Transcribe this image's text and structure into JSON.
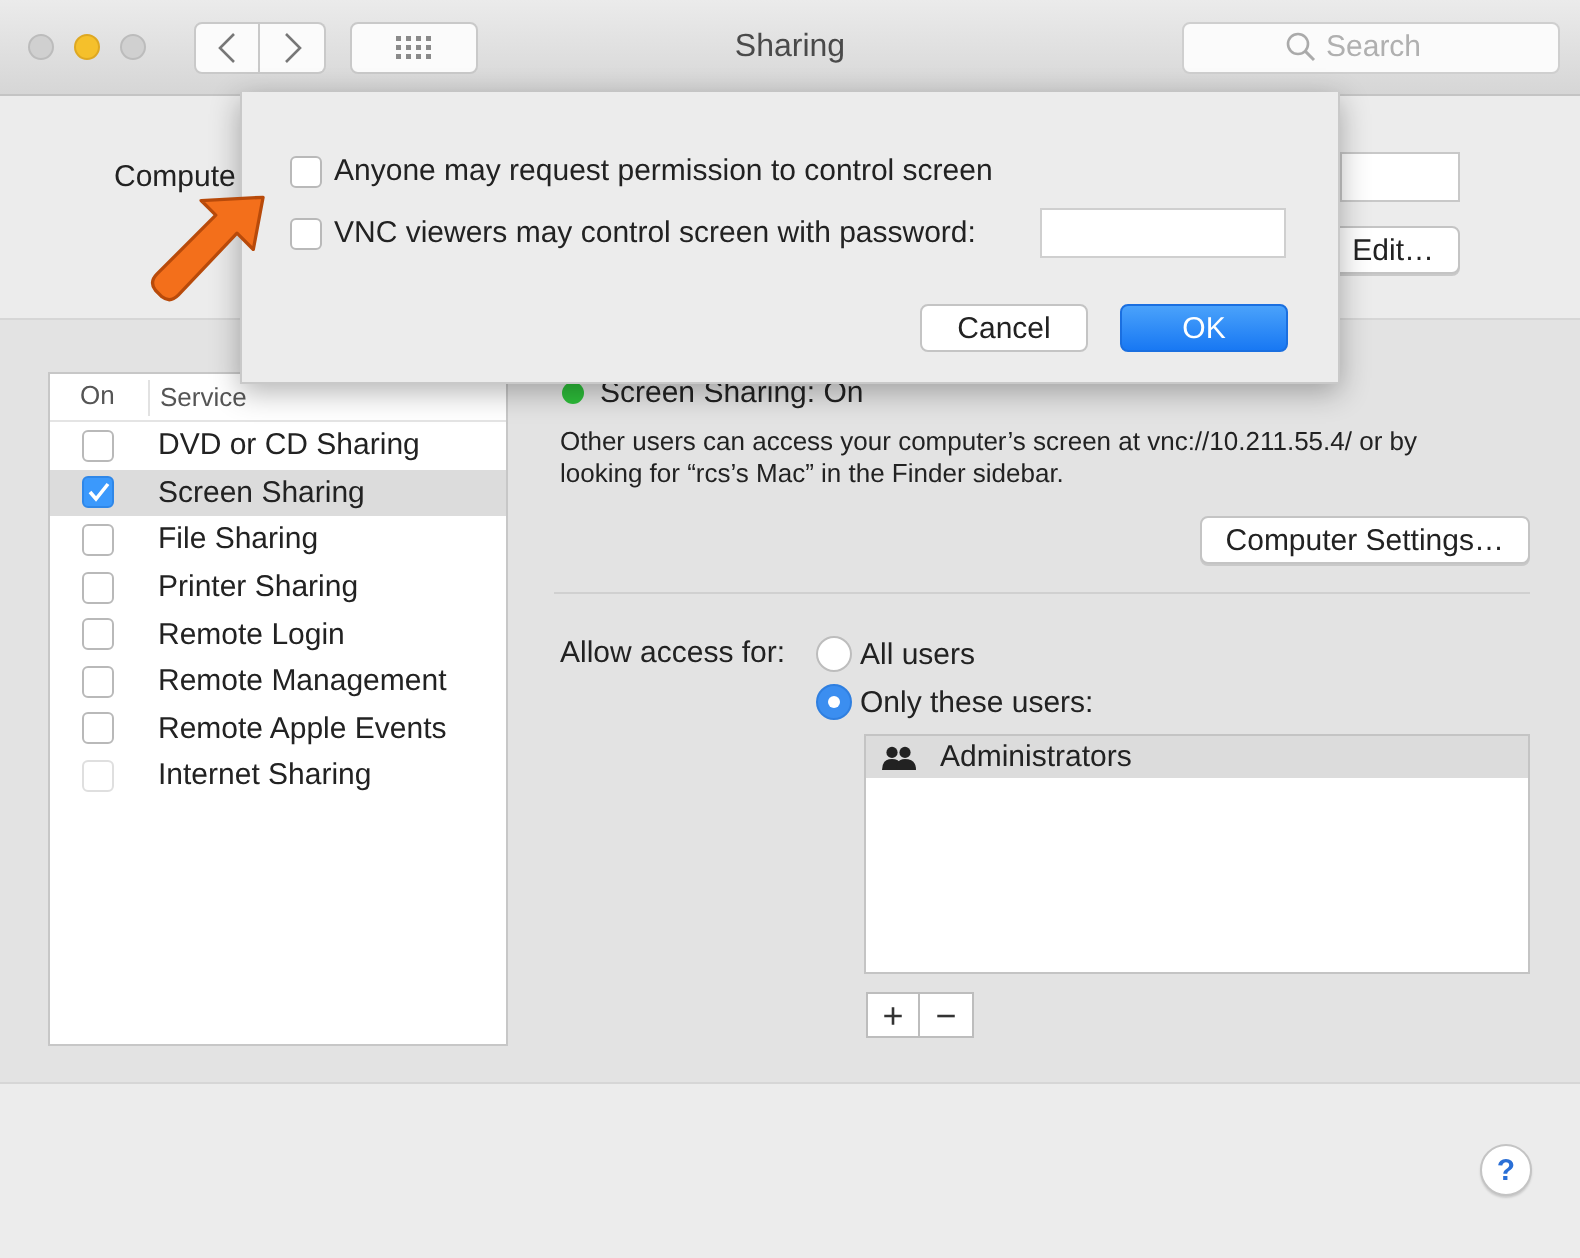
{
  "window": {
    "title": "Sharing",
    "search": {
      "placeholder": "Search"
    }
  },
  "computer_name": {
    "label": "Compute",
    "edit_button": "Edit…"
  },
  "services": {
    "columns": [
      "On",
      "Service"
    ],
    "items": [
      {
        "name": "DVD or CD Sharing",
        "checked": false,
        "selected": false,
        "disabled": false
      },
      {
        "name": "Screen Sharing",
        "checked": true,
        "selected": true,
        "disabled": false
      },
      {
        "name": "File Sharing",
        "checked": false,
        "selected": false,
        "disabled": false
      },
      {
        "name": "Printer Sharing",
        "checked": false,
        "selected": false,
        "disabled": false
      },
      {
        "name": "Remote Login",
        "checked": false,
        "selected": false,
        "disabled": false
      },
      {
        "name": "Remote Management",
        "checked": false,
        "selected": false,
        "disabled": false
      },
      {
        "name": "Remote Apple Events",
        "checked": false,
        "selected": false,
        "disabled": false
      },
      {
        "name": "Internet Sharing",
        "checked": false,
        "selected": false,
        "disabled": true
      }
    ]
  },
  "status": {
    "on": true,
    "text": "Screen Sharing: On"
  },
  "description": "Other users can access your computer’s screen at vnc://10.211.55.4/ or by looking for “rcs’s Mac” in the Finder sidebar.",
  "computer_settings_button": "Computer Settings…",
  "access": {
    "label": "Allow access for:",
    "options": [
      {
        "label": "All users",
        "selected": false
      },
      {
        "label": "Only these users:",
        "selected": true
      }
    ]
  },
  "users": [
    {
      "name": "Administrators",
      "selected": true
    }
  ],
  "user_buttons": [
    "+",
    "−"
  ],
  "help_button": "?",
  "sheet": {
    "options": [
      {
        "kind": "checkbox",
        "label": "Anyone may request permission to control screen",
        "checked": false
      },
      {
        "kind": "password",
        "label": "VNC viewers may control screen with password:",
        "checked": false
      }
    ],
    "buttons": [
      {
        "label": "Cancel",
        "default": false
      },
      {
        "label": "OK",
        "default": true
      }
    ]
  }
}
